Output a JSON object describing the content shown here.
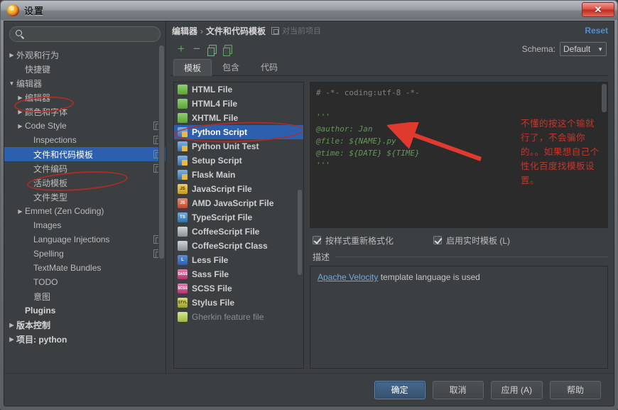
{
  "window": {
    "title": "设置",
    "close_label": "✕",
    "app_icon": "settings-gear-icon"
  },
  "sidebar": {
    "search_placeholder": "",
    "search_value": "",
    "search_icon": "search-icon",
    "items": [
      {
        "label": "外观和行为",
        "arrow": "▶",
        "indent": 0,
        "bold": false,
        "selected": false,
        "copy": false
      },
      {
        "label": "快捷键",
        "arrow": "",
        "indent": 1,
        "bold": false,
        "selected": false,
        "copy": false
      },
      {
        "label": "编辑器",
        "arrow": "▼",
        "indent": 0,
        "bold": false,
        "selected": false,
        "copy": false
      },
      {
        "label": "编辑器",
        "arrow": "▶",
        "indent": 1,
        "bold": false,
        "selected": false,
        "copy": false
      },
      {
        "label": "颜色和字体",
        "arrow": "▶",
        "indent": 1,
        "bold": false,
        "selected": false,
        "copy": false
      },
      {
        "label": "Code Style",
        "arrow": "▶",
        "indent": 1,
        "bold": false,
        "selected": false,
        "copy": true
      },
      {
        "label": "Inspections",
        "arrow": "",
        "indent": 2,
        "bold": false,
        "selected": false,
        "copy": true
      },
      {
        "label": "文件和代码模板",
        "arrow": "",
        "indent": 2,
        "bold": false,
        "selected": true,
        "copy": true
      },
      {
        "label": "文件编码",
        "arrow": "",
        "indent": 2,
        "bold": false,
        "selected": false,
        "copy": true
      },
      {
        "label": "活动模板",
        "arrow": "",
        "indent": 2,
        "bold": false,
        "selected": false,
        "copy": false
      },
      {
        "label": "文件类型",
        "arrow": "",
        "indent": 2,
        "bold": false,
        "selected": false,
        "copy": false
      },
      {
        "label": "Emmet (Zen Coding)",
        "arrow": "▶",
        "indent": 1,
        "bold": false,
        "selected": false,
        "copy": false
      },
      {
        "label": "Images",
        "arrow": "",
        "indent": 2,
        "bold": false,
        "selected": false,
        "copy": false
      },
      {
        "label": "Language Injections",
        "arrow": "",
        "indent": 2,
        "bold": false,
        "selected": false,
        "copy": true
      },
      {
        "label": "Spelling",
        "arrow": "",
        "indent": 2,
        "bold": false,
        "selected": false,
        "copy": true
      },
      {
        "label": "TextMate Bundles",
        "arrow": "",
        "indent": 2,
        "bold": false,
        "selected": false,
        "copy": false
      },
      {
        "label": "TODO",
        "arrow": "",
        "indent": 2,
        "bold": false,
        "selected": false,
        "copy": false
      },
      {
        "label": "意图",
        "arrow": "",
        "indent": 2,
        "bold": false,
        "selected": false,
        "copy": false
      },
      {
        "label": "Plugins",
        "arrow": "",
        "indent": 1,
        "bold": true,
        "selected": false,
        "copy": false
      },
      {
        "label": "版本控制",
        "arrow": "▶",
        "indent": 0,
        "bold": true,
        "selected": false,
        "copy": false
      },
      {
        "label": "项目: python",
        "arrow": "▶",
        "indent": 0,
        "bold": true,
        "selected": false,
        "copy": false
      }
    ]
  },
  "header": {
    "breadcrumb_root": "编辑器",
    "breadcrumb_sep": "›",
    "breadcrumb_current": "文件和代码模板",
    "scope_icon": "scope-icon",
    "scope_label": "对当前项目",
    "reset_label": "Reset"
  },
  "toolbar": {
    "add_label": "+",
    "remove_label": "−",
    "copy_icon": "copy-icon",
    "reset_template_icon": "restore-icon",
    "schema_label": "Schema:",
    "schema_value": "Default",
    "schema_caret": "▼"
  },
  "tabs": [
    {
      "label": "模板",
      "active": true
    },
    {
      "label": "包含",
      "active": false
    },
    {
      "label": "代码",
      "active": false
    }
  ],
  "template_list": [
    {
      "label": "HTML File",
      "icon": "html",
      "selected": false,
      "dim": false,
      "glyph": ""
    },
    {
      "label": "HTML4 File",
      "icon": "html",
      "selected": false,
      "dim": false,
      "glyph": ""
    },
    {
      "label": "XHTML File",
      "icon": "html",
      "selected": false,
      "dim": false,
      "glyph": ""
    },
    {
      "label": "Python Script",
      "icon": "py",
      "selected": true,
      "dim": false,
      "glyph": ""
    },
    {
      "label": "Python Unit Test",
      "icon": "py",
      "selected": false,
      "dim": false,
      "glyph": ""
    },
    {
      "label": "Setup Script",
      "icon": "py",
      "selected": false,
      "dim": false,
      "glyph": ""
    },
    {
      "label": "Flask Main",
      "icon": "py",
      "selected": false,
      "dim": false,
      "glyph": ""
    },
    {
      "label": "JavaScript File",
      "icon": "js",
      "selected": false,
      "dim": false,
      "glyph": "JS"
    },
    {
      "label": "AMD JavaScript File",
      "icon": "amd",
      "selected": false,
      "dim": false,
      "glyph": "JS"
    },
    {
      "label": "TypeScript File",
      "icon": "ts",
      "selected": false,
      "dim": false,
      "glyph": "TS"
    },
    {
      "label": "CoffeeScript File",
      "icon": "coffee",
      "selected": false,
      "dim": false,
      "glyph": ""
    },
    {
      "label": "CoffeeScript Class",
      "icon": "coffee",
      "selected": false,
      "dim": false,
      "glyph": ""
    },
    {
      "label": "Less File",
      "icon": "less",
      "selected": false,
      "dim": false,
      "glyph": "L"
    },
    {
      "label": "Sass File",
      "icon": "sass",
      "selected": false,
      "dim": false,
      "glyph": "SASS"
    },
    {
      "label": "SCSS File",
      "icon": "sass",
      "selected": false,
      "dim": false,
      "glyph": "SCSS"
    },
    {
      "label": "Stylus File",
      "icon": "stylus",
      "selected": false,
      "dim": false,
      "glyph": "STYL"
    },
    {
      "label": "Gherkin feature file",
      "icon": "gherkin",
      "selected": false,
      "dim": true,
      "glyph": ""
    }
  ],
  "editor": {
    "lines": [
      {
        "text": "# -*- coding:utf-8 -*-",
        "cls": "cm"
      },
      {
        "text": "",
        "cls": ""
      },
      {
        "text": "'''",
        "cls": "doc"
      },
      {
        "text": "@author: Jan",
        "cls": "doc"
      },
      {
        "text": "@file: ${NAME}.py",
        "cls": "doc"
      },
      {
        "text": "@time: ${DATE} ${TIME}",
        "cls": "doc"
      },
      {
        "text": "'''",
        "cls": "doc"
      }
    ]
  },
  "annotation": {
    "text": "不懂的按这个输就行了，不会骗你的。。如果想自己个性化百度找模板设置。",
    "color": "#c7352b",
    "arrow_icon": "red-arrow-icon"
  },
  "options": {
    "reformat_label": "按样式重新格式化",
    "reformat_checked": true,
    "live_template_label": "启用实时模板 (L)",
    "live_template_checked": true
  },
  "description": {
    "section_label": "描述",
    "link_text": "Apache Velocity",
    "rest_text": " template language is used"
  },
  "footer": {
    "ok": "确定",
    "cancel": "取消",
    "apply": "应用 (A)",
    "help": "帮助"
  }
}
